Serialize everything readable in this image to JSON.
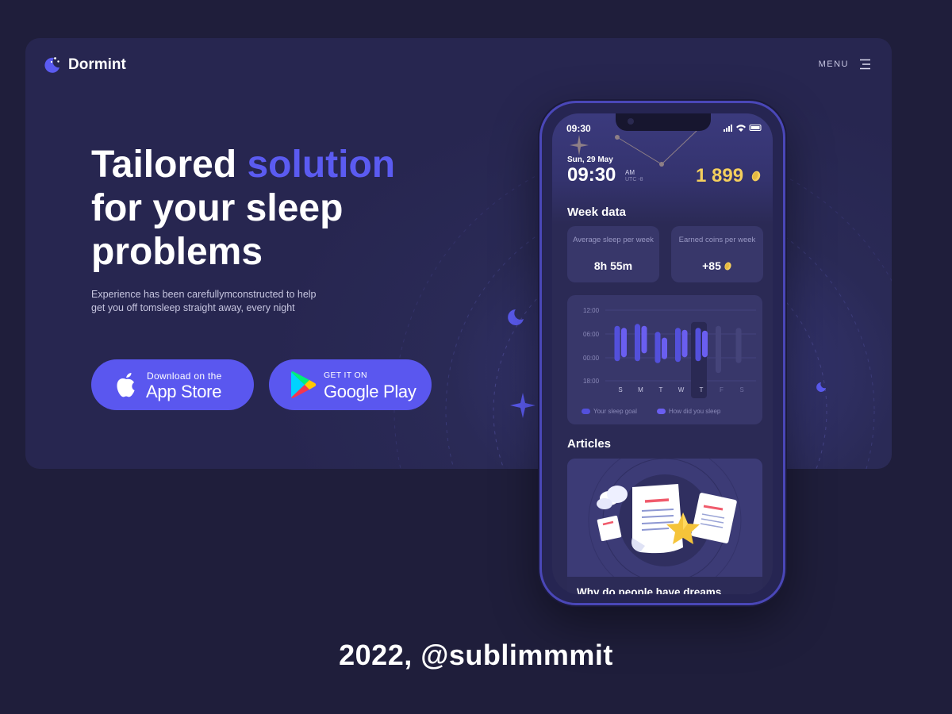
{
  "brand": {
    "name": "Dormint"
  },
  "nav": {
    "menu_label": "MENU"
  },
  "hero": {
    "headline_part1": "Tailored ",
    "headline_accent": "solution",
    "headline_part2": "for your sleep problems",
    "subtext": "Experience has been carefullymconstructed to help get you off tomsleep straight away, every night"
  },
  "stores": {
    "apple": {
      "small": "Download on the",
      "big": "App Store"
    },
    "google": {
      "small": "GET IT ON",
      "big": "Google Play"
    }
  },
  "phone": {
    "status_time": "09:30",
    "date": "Sun, 29 May",
    "clock": "09:30",
    "ampm": "AM",
    "timezone": "UTC -8",
    "coins": "1 899",
    "week_title": "Week data",
    "stats": [
      {
        "label": "Average sleep per week",
        "value": "8h 55m"
      },
      {
        "label": "Earned coins per week",
        "value": "+85"
      }
    ],
    "legend": {
      "goal": "Your sleep goal",
      "actual": "How did you sleep"
    },
    "articles_title": "Articles",
    "article_caption": "Why do people have dreams"
  },
  "chart_data": {
    "type": "bar",
    "categories": [
      "S",
      "M",
      "T",
      "W",
      "T",
      "F",
      "S"
    ],
    "y_ticks": [
      "12:00",
      "06:00",
      "00:00",
      "18:00"
    ],
    "series": [
      {
        "name": "Your sleep goal",
        "ranges": [
          [
            -1,
            8
          ],
          [
            -1,
            8.5
          ],
          [
            -1.5,
            6.5
          ],
          [
            -1.2,
            7.5
          ],
          [
            -1,
            7.5
          ],
          [
            -4,
            8
          ],
          [
            -1.5,
            7.5
          ]
        ]
      },
      {
        "name": "How did you sleep",
        "ranges": [
          [
            0,
            7.5
          ],
          [
            1,
            8
          ],
          [
            -0.5,
            5
          ],
          [
            0,
            7
          ],
          [
            0,
            6.8
          ],
          null,
          null
        ]
      }
    ],
    "highlighted_category_index": 4
  },
  "footer": {
    "credit": "2022, @sublimmmit"
  },
  "colors": {
    "accent": "#5b5bf1",
    "coin": "#f4cf5d",
    "background": "#1f1e3b"
  }
}
